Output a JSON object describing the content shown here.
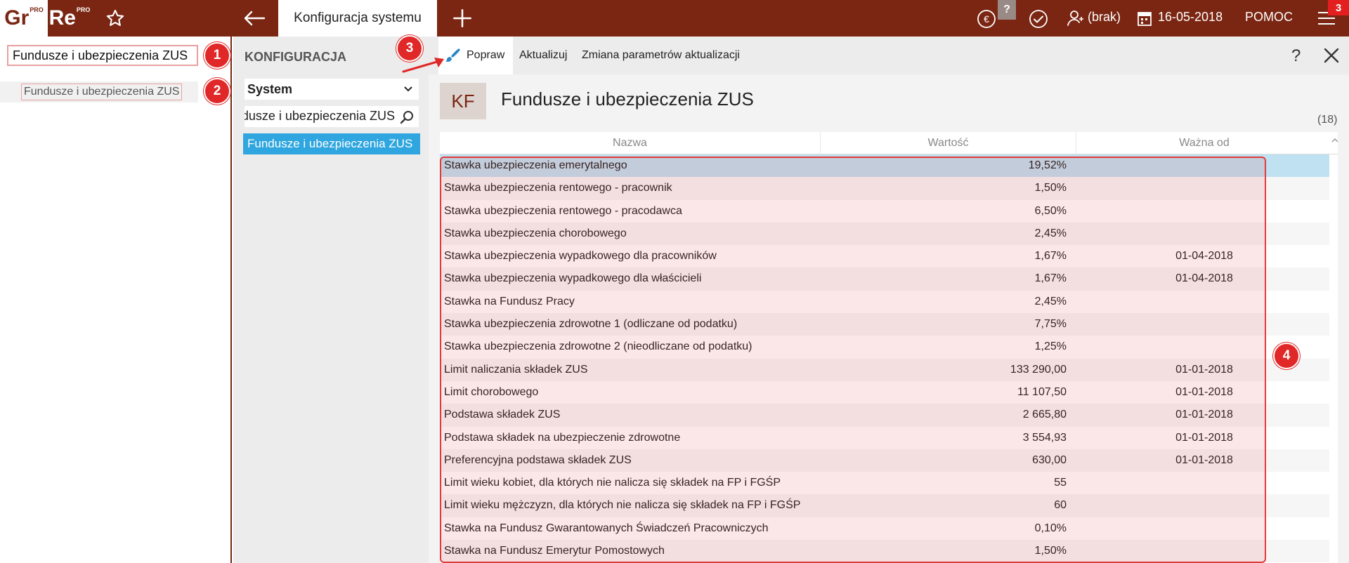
{
  "topbar": {
    "logo_gr": "Gr",
    "logo_re": "Re",
    "logo_sup": "PRO",
    "active_tab": "Konfiguracja systemu",
    "help_badge": "?",
    "user": "(brak)",
    "date": "16-05-2018",
    "help_link": "POMOC",
    "notification_count": "3",
    "icons": [
      "star-icon",
      "back-icon",
      "plus-icon",
      "euro-icon",
      "check-icon",
      "user-icon",
      "calendar-icon",
      "menu-icon"
    ],
    "colors": {
      "bar": "#7a2612",
      "badge": "#e41f1f"
    }
  },
  "left_panel": {
    "search_value": "Fundusze i ubezpieczenia ZUS",
    "result": "Fundusze i ubezpieczenia ZUS"
  },
  "config": {
    "title": "KONFIGURACJA",
    "select_value": "System",
    "search_value": "Fundusze i ubezpieczenia ZUS",
    "selected_item": "Fundusze i ubezpieczenia ZUS",
    "accent": "#2fa6df"
  },
  "toolbar": {
    "popraw": "Popraw",
    "aktualizuj": "Aktualizuj",
    "zmiana": "Zmiana parametrów aktualizacji",
    "help": "?"
  },
  "header": {
    "icon_text": "KF",
    "title": "Fundusze i ubezpieczenia ZUS",
    "count": "(18)"
  },
  "grid": {
    "columns": [
      "Nazwa",
      "Wartość",
      "Ważna od"
    ],
    "rows": [
      {
        "name": "Stawka ubezpieczenia emerytalnego",
        "value": "19,52%",
        "date": ""
      },
      {
        "name": "Stawka ubezpieczenia rentowego - pracownik",
        "value": "1,50%",
        "date": ""
      },
      {
        "name": "Stawka ubezpieczenia rentowego - pracodawca",
        "value": "6,50%",
        "date": ""
      },
      {
        "name": "Stawka ubezpieczenia chorobowego",
        "value": "2,45%",
        "date": ""
      },
      {
        "name": "Stawka ubezpieczenia wypadkowego dla pracowników",
        "value": "1,67%",
        "date": "01-04-2018"
      },
      {
        "name": "Stawka ubezpieczenia wypadkowego dla właścicieli",
        "value": "1,67%",
        "date": "01-04-2018"
      },
      {
        "name": "Stawka na Fundusz Pracy",
        "value": "2,45%",
        "date": ""
      },
      {
        "name": "Stawka ubezpieczenia zdrowotne 1 (odliczane od podatku)",
        "value": "7,75%",
        "date": ""
      },
      {
        "name": "Stawka ubezpieczenia zdrowotne 2 (nieodliczane od podatku)",
        "value": "1,25%",
        "date": ""
      },
      {
        "name": "Limit naliczania składek ZUS",
        "value": "133 290,00",
        "date": "01-01-2018"
      },
      {
        "name": "Limit chorobowego",
        "value": "11 107,50",
        "date": "01-01-2018"
      },
      {
        "name": "Podstawa składek ZUS",
        "value": "2 665,80",
        "date": "01-01-2018"
      },
      {
        "name": "Podstawa składek na ubezpieczenie zdrowotne",
        "value": "3 554,93",
        "date": "01-01-2018"
      },
      {
        "name": "Preferencyjna podstawa składek ZUS",
        "value": "630,00",
        "date": "01-01-2018"
      },
      {
        "name": "Limit wieku kobiet, dla których nie nalicza się składek na FP i FGŚP",
        "value": "55",
        "date": ""
      },
      {
        "name": "Limit wieku mężczyzn, dla których nie nalicza się składek na FP i FGŚP",
        "value": "60",
        "date": ""
      },
      {
        "name": "Stawka na Fundusz Gwarantowanych Świadczeń Pracowniczych",
        "value": "0,10%",
        "date": ""
      },
      {
        "name": "Stawka na Fundusz Emerytur Pomostowych",
        "value": "1,50%",
        "date": ""
      }
    ]
  },
  "callouts": [
    "1",
    "2",
    "3",
    "4"
  ]
}
